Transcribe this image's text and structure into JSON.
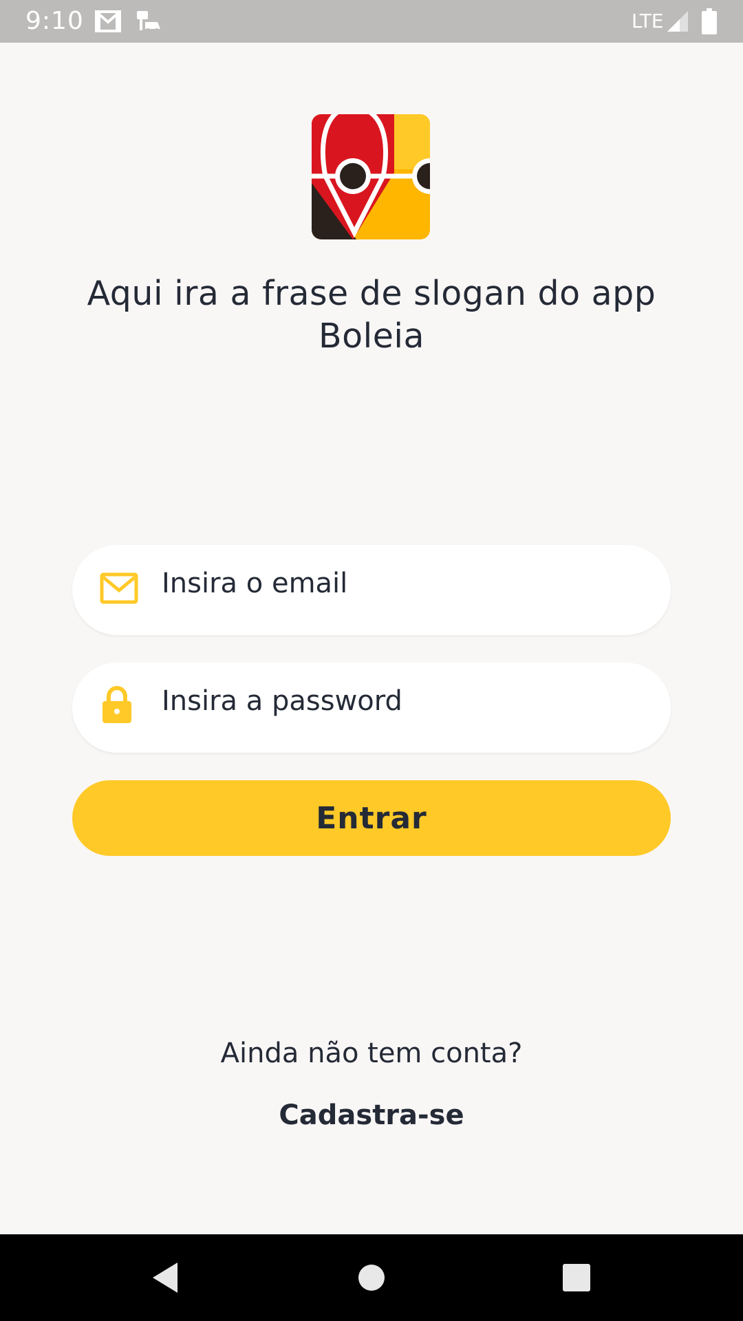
{
  "status_bar": {
    "time": "9:10",
    "network": "LTE",
    "icons": [
      "gmail-icon",
      "car-notification-icon",
      "signal-icon",
      "battery-icon"
    ]
  },
  "app": {
    "name": "Boleia",
    "slogan": "Aqui ira a frase de slogan do app Boleia",
    "logo_colors": {
      "red": "#d9161f",
      "yellow": "#ffb600",
      "dark": "#2a211c"
    }
  },
  "login_form": {
    "email_placeholder": "Insira o email",
    "email_value": "",
    "password_placeholder": "Insira a password",
    "password_value": "",
    "submit_label": "Entrar"
  },
  "signup": {
    "prompt": "Ainda não tem conta?",
    "link_label": "Cadastra-se"
  },
  "theme": {
    "accent": "#ffc928",
    "background": "#f9f7f6",
    "text": "#242a36"
  },
  "nav_bar": {
    "buttons": [
      "back-icon",
      "home-icon",
      "recents-icon"
    ]
  }
}
